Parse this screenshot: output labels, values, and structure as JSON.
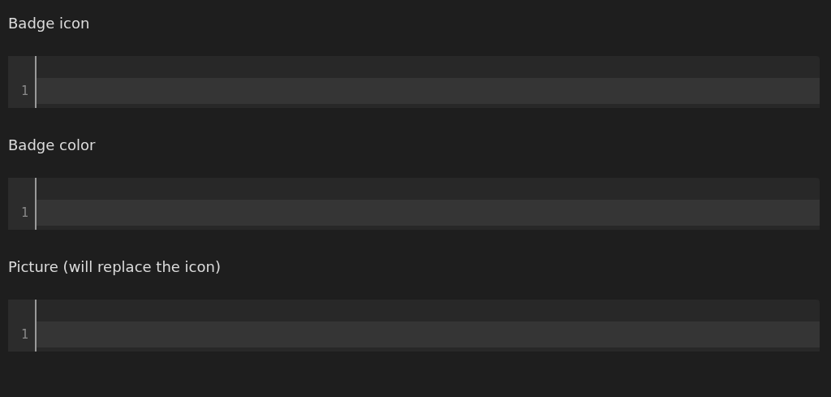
{
  "fields": [
    {
      "label": "Badge icon",
      "lines": [
        "1"
      ]
    },
    {
      "label": "Badge color",
      "lines": [
        "1"
      ]
    },
    {
      "label": "Picture (will replace the icon)",
      "lines": [
        "1"
      ]
    }
  ]
}
